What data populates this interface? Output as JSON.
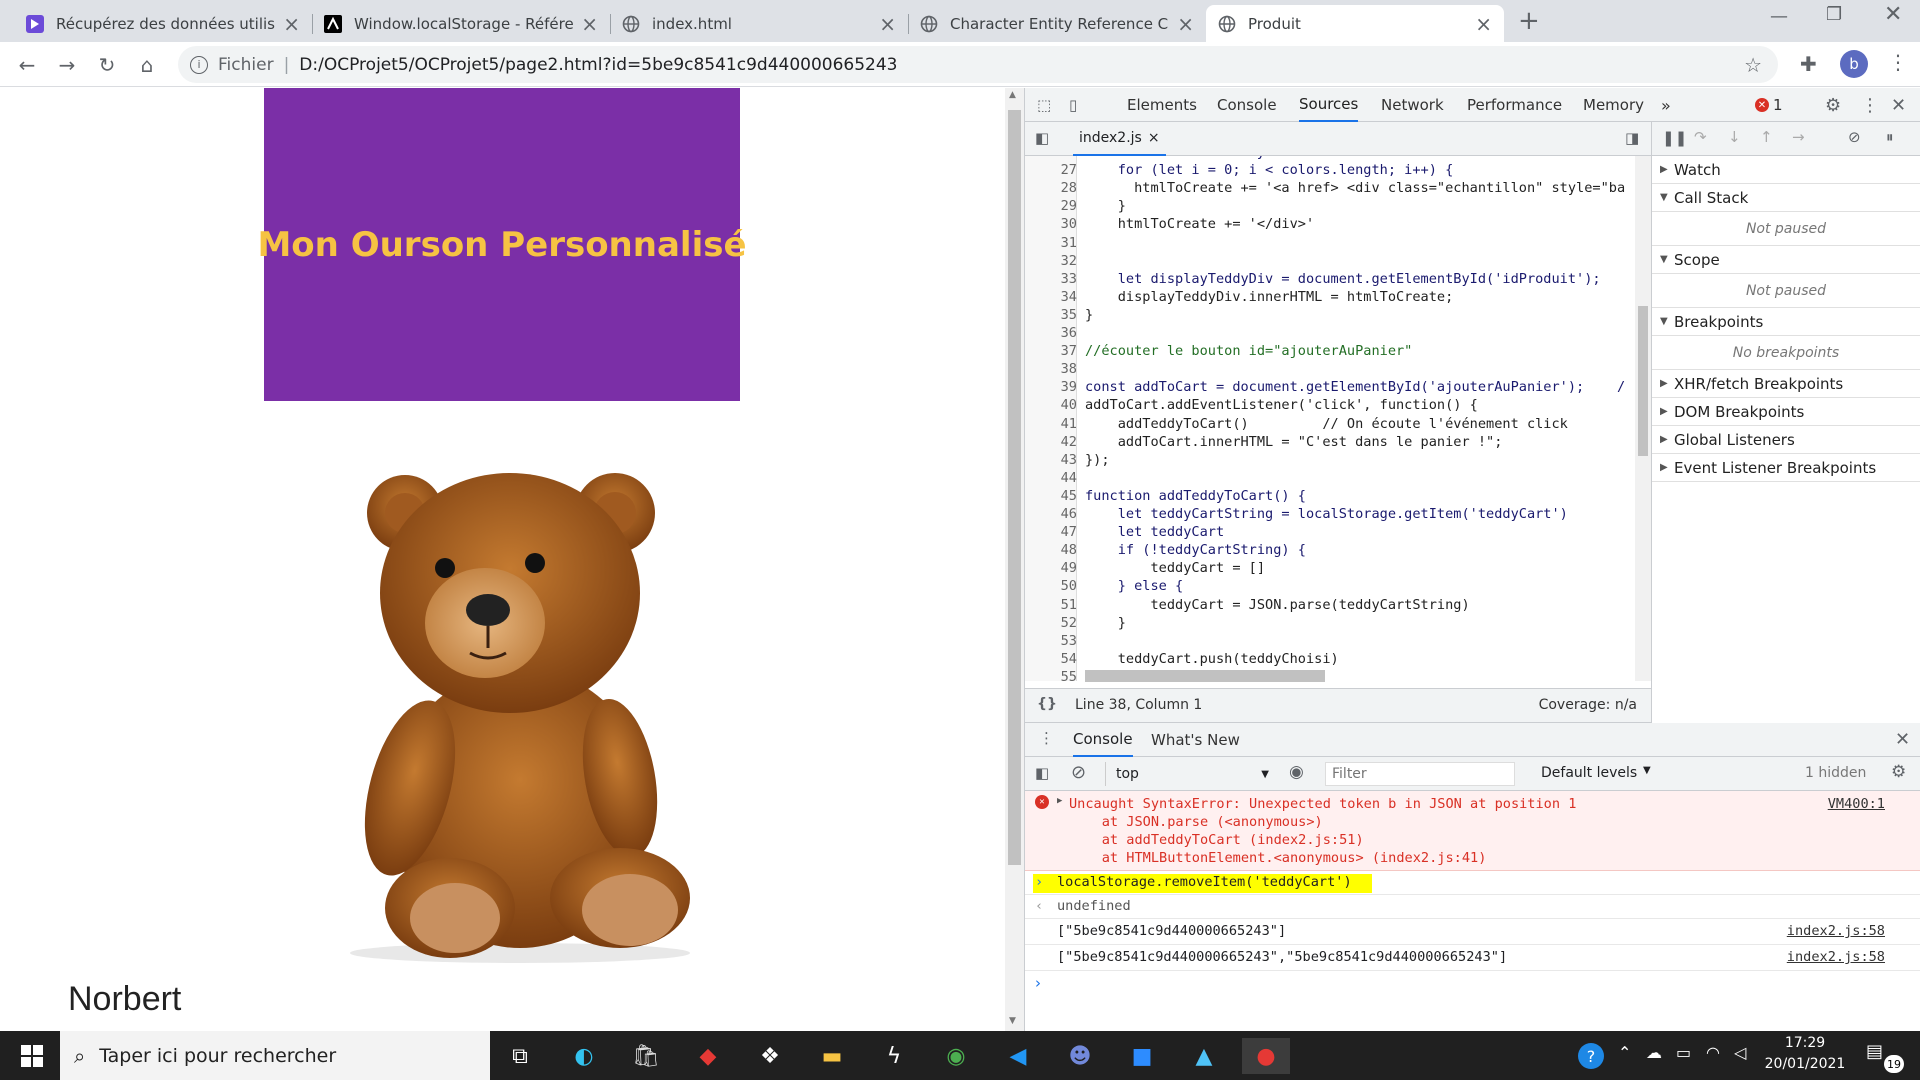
{
  "tabs": [
    {
      "title": "Récupérez des données utilisateu",
      "favicon": "openclassrooms-icon",
      "color": "#6c4bd8"
    },
    {
      "title": "Window.localStorage - Référence",
      "favicon": "mdn-icon",
      "color": "#000000"
    },
    {
      "title": "index.html",
      "favicon": "globe-icon",
      "color": "#5f6368"
    },
    {
      "title": "Character Entity Reference Chart",
      "favicon": "globe-icon",
      "color": "#5f6368"
    },
    {
      "title": "Produit",
      "favicon": "globe-icon",
      "color": "#5f6368",
      "active": true
    }
  ],
  "omnibar": {
    "scheme": "Fichier",
    "url": "D:/OCProjet5/OCProjet5/page2.html?id=5be9c8541c9d440000665243",
    "profile_initial": "b"
  },
  "page": {
    "banner_title": "Mon Ourson Personnalisé",
    "banner_color": "#7b2fa7",
    "banner_text_color": "#f6c343",
    "product_name": "Norbert"
  },
  "devtools": {
    "tabs": [
      "Elements",
      "Console",
      "Sources",
      "Network",
      "Performance",
      "Memory"
    ],
    "active_tab": "Sources",
    "error_count": "1",
    "file_tab": "index2.js",
    "status": "Line 38, Column 1",
    "coverage": "Coverage: n/a",
    "code": [
      {
        "n": "26",
        "t": "    let colors = teddy.colors"
      },
      {
        "n": "27",
        "t": "    for (let i = 0; i < colors.length; i++) {"
      },
      {
        "n": "28",
        "t": "      htmlToCreate += '<a href> <div class=\"echantillon\" style=\"ba"
      },
      {
        "n": "29",
        "t": "    }"
      },
      {
        "n": "30",
        "t": "    htmlToCreate += '</div>'"
      },
      {
        "n": "31",
        "t": ""
      },
      {
        "n": "32",
        "t": ""
      },
      {
        "n": "33",
        "t": "    let displayTeddyDiv = document.getElementById('idProduit');"
      },
      {
        "n": "34",
        "t": "    displayTeddyDiv.innerHTML = htmlToCreate;"
      },
      {
        "n": "35",
        "t": "}"
      },
      {
        "n": "36",
        "t": ""
      },
      {
        "n": "37",
        "t": "//écouter le bouton id=\"ajouterAuPanier\""
      },
      {
        "n": "38",
        "t": ""
      },
      {
        "n": "39",
        "t": "const addToCart = document.getElementById('ajouterAuPanier');    /"
      },
      {
        "n": "40",
        "t": "addToCart.addEventListener('click', function() {"
      },
      {
        "n": "41",
        "t": "    addTeddyToCart()         // On écoute l'événement click"
      },
      {
        "n": "42",
        "t": "    addToCart.innerHTML = \"C'est dans le panier !\";"
      },
      {
        "n": "43",
        "t": "});"
      },
      {
        "n": "44",
        "t": ""
      },
      {
        "n": "45",
        "t": "function addTeddyToCart() {"
      },
      {
        "n": "46",
        "t": "    let teddyCartString = localStorage.getItem('teddyCart')"
      },
      {
        "n": "47",
        "t": "    let teddyCart"
      },
      {
        "n": "48",
        "t": "    if (!teddyCartString) {"
      },
      {
        "n": "49",
        "t": "        teddyCart = []"
      },
      {
        "n": "50",
        "t": "    } else {"
      },
      {
        "n": "51",
        "t": "        teddyCart = JSON.parse(teddyCartString)"
      },
      {
        "n": "52",
        "t": "    }"
      },
      {
        "n": "53",
        "t": ""
      },
      {
        "n": "54",
        "t": "    teddyCart.push(teddyChoisi)"
      },
      {
        "n": "55",
        "t": ""
      }
    ],
    "panes": {
      "watch": "Watch",
      "call_stack": "Call Stack",
      "not_paused": "Not paused",
      "scope": "Scope",
      "breakpoints": "Breakpoints",
      "no_breakpoints": "No breakpoints",
      "xhr": "XHR/fetch Breakpoints",
      "dom": "DOM Breakpoints",
      "global": "Global Listeners",
      "event": "Event Listener Breakpoints"
    },
    "drawer_tabs": [
      "Console",
      "What's New"
    ],
    "console_context": "top",
    "filter_placeholder": "Filter",
    "levels": "Default levels",
    "hidden": "1 hidden",
    "error": {
      "message": "Uncaught SyntaxError: Unexpected token b in JSON at position 1",
      "source": "VM400:1",
      "stack": [
        "    at JSON.parse (<anonymous>)",
        "    at addTeddyToCart (index2.js:51)",
        "    at HTMLButtonElement.<anonymous> (index2.js:41)"
      ]
    },
    "command": "localStorage.removeItem('teddyCart')",
    "result": "undefined",
    "logs": [
      {
        "text": "[\"5be9c8541c9d440000665243\"]",
        "source": "index2.js:58"
      },
      {
        "text": "[\"5be9c8541c9d440000665243\",\"5be9c8541c9d440000665243\"]",
        "source": "index2.js:58"
      }
    ]
  },
  "taskbar": {
    "search_placeholder": "Taper ici pour rechercher",
    "time": "17:29",
    "date": "20/01/2021",
    "notification_count": "19"
  }
}
